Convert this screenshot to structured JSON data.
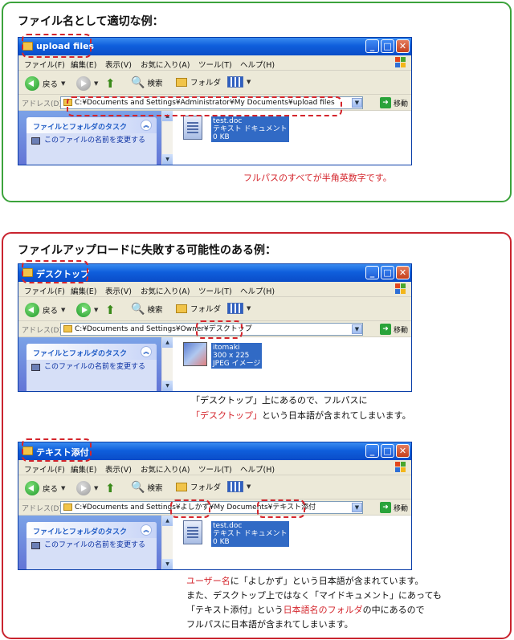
{
  "colors": {
    "good": "#3ca33c",
    "bad": "#c9242f",
    "highlight": "#d4252c"
  },
  "windowTemplate": {
    "menu": [
      "ファイル(F)",
      "編集(E)",
      "表示(V)",
      "お気に入り(A)",
      "ツール(T)",
      "ヘルプ(H)"
    ],
    "back": "戻る",
    "search": "検索",
    "folders": "フォルダ",
    "address_label": "アドレス(D)",
    "go": "移動",
    "task_header": "ファイルとフォルダのタスク",
    "task_item": "このファイルの名前を変更する",
    "icons": {
      "min": "minimize-icon",
      "max": "maximize-icon",
      "close": "close-icon"
    }
  },
  "good": {
    "title": "ファイル名として適切な例：",
    "window": {
      "title": "upload files",
      "address": "C:¥Documents and Settings¥Administrator¥My Documents¥upload files",
      "file": {
        "name": "test.doc",
        "type": "テキスト ドキュメント",
        "size": "0 KB"
      }
    },
    "note": "フルパスのすべてが半角英数字です。"
  },
  "bad": {
    "title": "ファイルアップロードに失敗する可能性のある例：",
    "window1": {
      "title": "デスクトップ",
      "address": "C:¥Documents and Settings¥Owner¥デスクトップ",
      "file": {
        "name": "itomaki",
        "type": "300 x 225",
        "size": "JPEG イメージ"
      }
    },
    "note1": {
      "line1": "「デスクトップ」上にあるので、フルパスに",
      "line2_red": "「デスクトップ」",
      "line2_rest": "という日本語が含まれてしまいます。"
    },
    "window2": {
      "title": "テキスト添付",
      "address": "C:¥Documents and Settings¥よしかず¥My Documents¥テキスト添付",
      "file": {
        "name": "test.doc",
        "type": "テキスト ドキュメント",
        "size": "0 KB"
      }
    },
    "note2": {
      "line1_red": "ユーザー名",
      "line1_rest": "に「よしかず」という日本語が含まれています。",
      "line2": "また、デスクトップ上ではなく「マイドキュメント」にあっても",
      "line3_a": "「テキスト添付」という",
      "line3_red": "日本語名のフォルダ",
      "line3_b": "の中にあるので",
      "line4": "フルパスに日本語が含まれてしまいます。"
    }
  }
}
